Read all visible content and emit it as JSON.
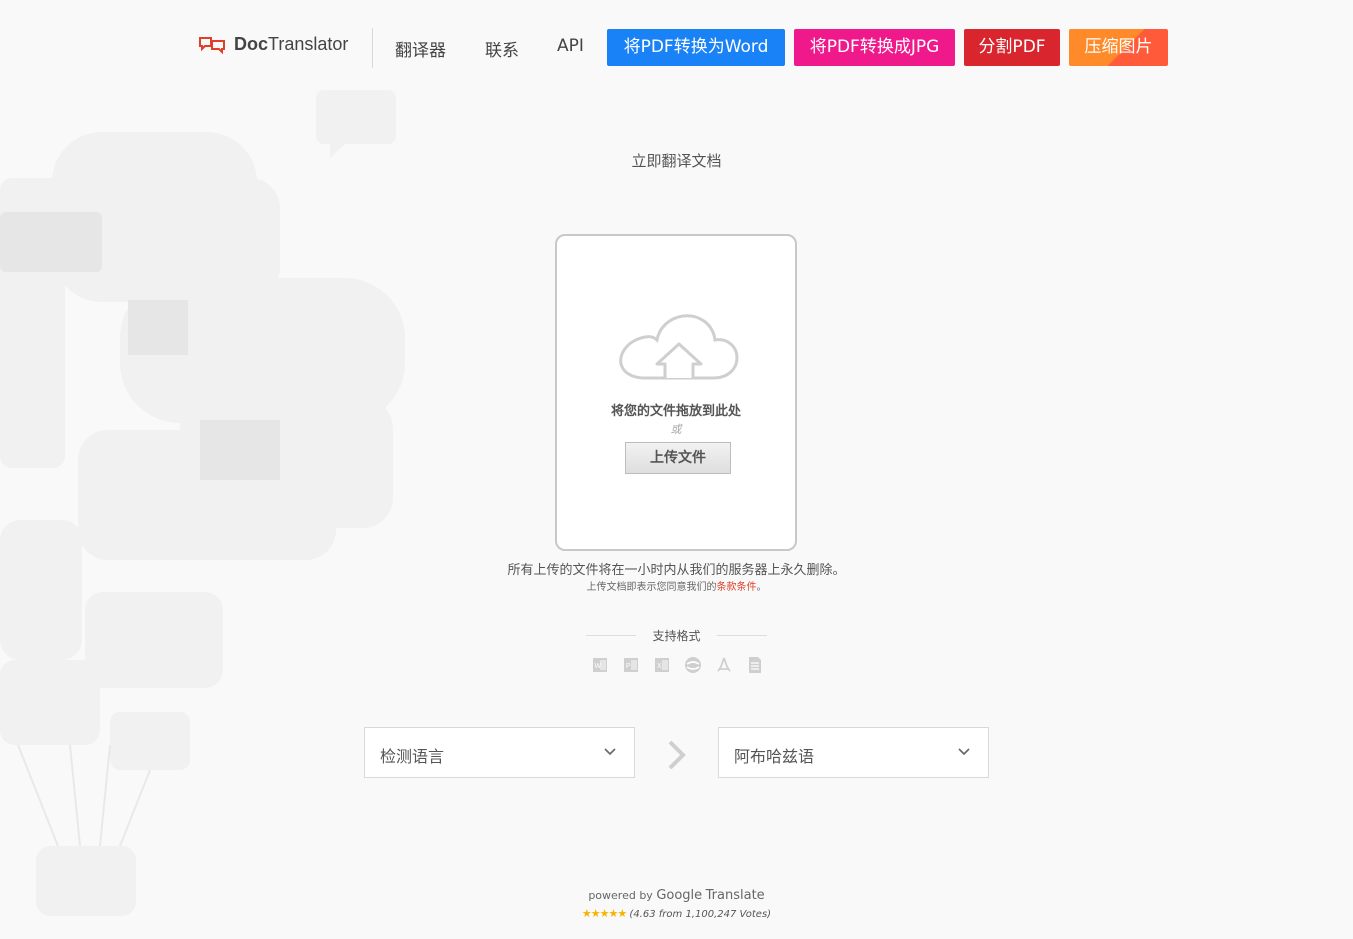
{
  "header": {
    "logo_text_bold": "Doc",
    "logo_text": "Translator",
    "nav": {
      "translator": "翻译器",
      "contact": "联系",
      "api": "API"
    },
    "buttons": [
      {
        "label": "将PDF转换为Word",
        "color": "#1a82f7"
      },
      {
        "label": "将PDF转换成JPG",
        "color": "#f0198c"
      },
      {
        "label": "分割PDF",
        "color": "#d9262e"
      },
      {
        "label": "压缩图片",
        "color": "#ff7f2a"
      }
    ]
  },
  "main": {
    "subtitle": "立即翻译文档",
    "dropzone": {
      "drop_text": "将您的文件拖放到此处",
      "or_text": "或",
      "upload_label": "上传文件"
    },
    "notice": "所有上传的文件将在一小时内从我们的服务器上永久删除。",
    "terms_prefix": "上传文档即表示您同意我们的",
    "terms_link": "条款条件",
    "terms_suffix": "。",
    "formats_label": "支持格式",
    "formats": [
      "word-icon",
      "powerpoint-icon",
      "excel-icon",
      "opendocument-icon",
      "pdf-icon",
      "text-file-icon"
    ]
  },
  "languages": {
    "source": "检测语言",
    "target": "阿布哈兹语"
  },
  "footer": {
    "powered_by": "powered by",
    "google": "Google",
    "translate": "Translate",
    "stars": "★★★★★",
    "votes": "(4.63 from 1,100,247 Votes)"
  },
  "colors": {
    "accent_red": "#e0402a",
    "background": "#f9f9f9"
  }
}
